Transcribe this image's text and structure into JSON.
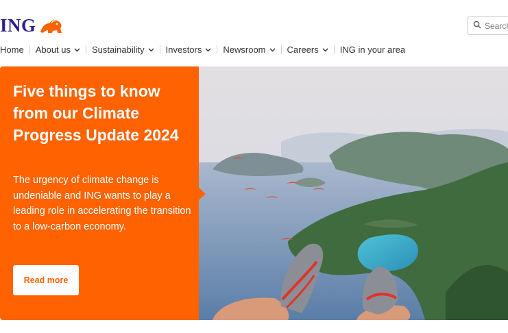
{
  "brand": {
    "name": "ING",
    "logo_icon": "lion-icon",
    "accent": "#ff6200",
    "navy": "#2b1f8f"
  },
  "search": {
    "placeholder": "Search",
    "icon": "search-icon"
  },
  "nav": {
    "items": [
      {
        "label": "Home",
        "dropdown": false
      },
      {
        "label": "About us",
        "dropdown": true
      },
      {
        "label": "Sustainability",
        "dropdown": true
      },
      {
        "label": "Investors",
        "dropdown": true
      },
      {
        "label": "Newsroom",
        "dropdown": true
      },
      {
        "label": "Careers",
        "dropdown": true
      },
      {
        "label": "ING in your area",
        "dropdown": false
      }
    ]
  },
  "hero": {
    "title": "Five things to know from our Climate Progress Update 2024",
    "description": "The urgency of climate change is undeniable and ING wants to play a leading role in accelerating the transition to a low-carbon economy.",
    "button_label": "Read more"
  }
}
